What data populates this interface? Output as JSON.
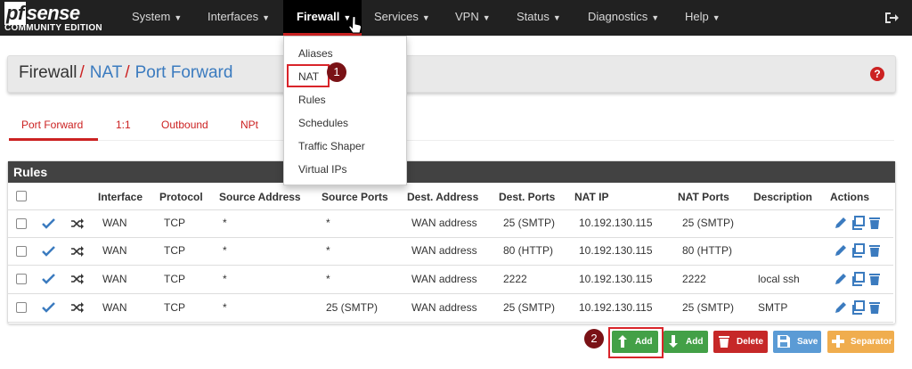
{
  "brand": {
    "logo": "sense",
    "logo_pf": "pf",
    "edition": "COMMUNITY EDITION"
  },
  "nav": [
    {
      "label": "System",
      "active": false
    },
    {
      "label": "Interfaces",
      "active": false
    },
    {
      "label": "Firewall",
      "active": true
    },
    {
      "label": "Services",
      "active": false
    },
    {
      "label": "VPN",
      "active": false
    },
    {
      "label": "Status",
      "active": false
    },
    {
      "label": "Diagnostics",
      "active": false
    },
    {
      "label": "Help",
      "active": false
    }
  ],
  "breadcrumb": {
    "part1": "Firewall",
    "part2": "NAT",
    "part3": "Port Forward",
    "separator": "/"
  },
  "help": "?",
  "dropdown": [
    "Aliases",
    "NAT",
    "Rules",
    "Schedules",
    "Traffic Shaper",
    "Virtual IPs"
  ],
  "callouts": {
    "one": "1",
    "two": "2"
  },
  "tabs": [
    "Port Forward",
    "1:1",
    "Outbound",
    "NPt"
  ],
  "rules": {
    "title": "Rules",
    "headers": [
      "Interface",
      "Protocol",
      "Source Address",
      "Source Ports",
      "Dest. Address",
      "Dest. Ports",
      "NAT IP",
      "NAT Ports",
      "Description",
      "Actions"
    ],
    "rows": [
      [
        "WAN",
        "TCP",
        "*",
        "*",
        "WAN address",
        "25 (SMTP)",
        "10.192.130.115",
        "25 (SMTP)",
        ""
      ],
      [
        "WAN",
        "TCP",
        "*",
        "*",
        "WAN address",
        "80 (HTTP)",
        "10.192.130.115",
        "80 (HTTP)",
        ""
      ],
      [
        "WAN",
        "TCP",
        "*",
        "*",
        "WAN address",
        "2222",
        "10.192.130.115",
        "2222",
        "local ssh"
      ],
      [
        "WAN",
        "TCP",
        "*",
        "25 (SMTP)",
        "WAN address",
        "25 (SMTP)",
        "10.192.130.115",
        "25 (SMTP)",
        "SMTP"
      ]
    ]
  },
  "buttons": {
    "add_top": "Add",
    "add_bottom": "Add",
    "delete": "Delete",
    "save": "Save",
    "separator": "Separator"
  },
  "colors": {
    "navbar": "#212121",
    "accent": "#cc2222",
    "link": "#3b7bbf",
    "success": "#43a047",
    "danger": "#c62828",
    "info": "#5b9bd5",
    "warning": "#f0ad4e"
  }
}
